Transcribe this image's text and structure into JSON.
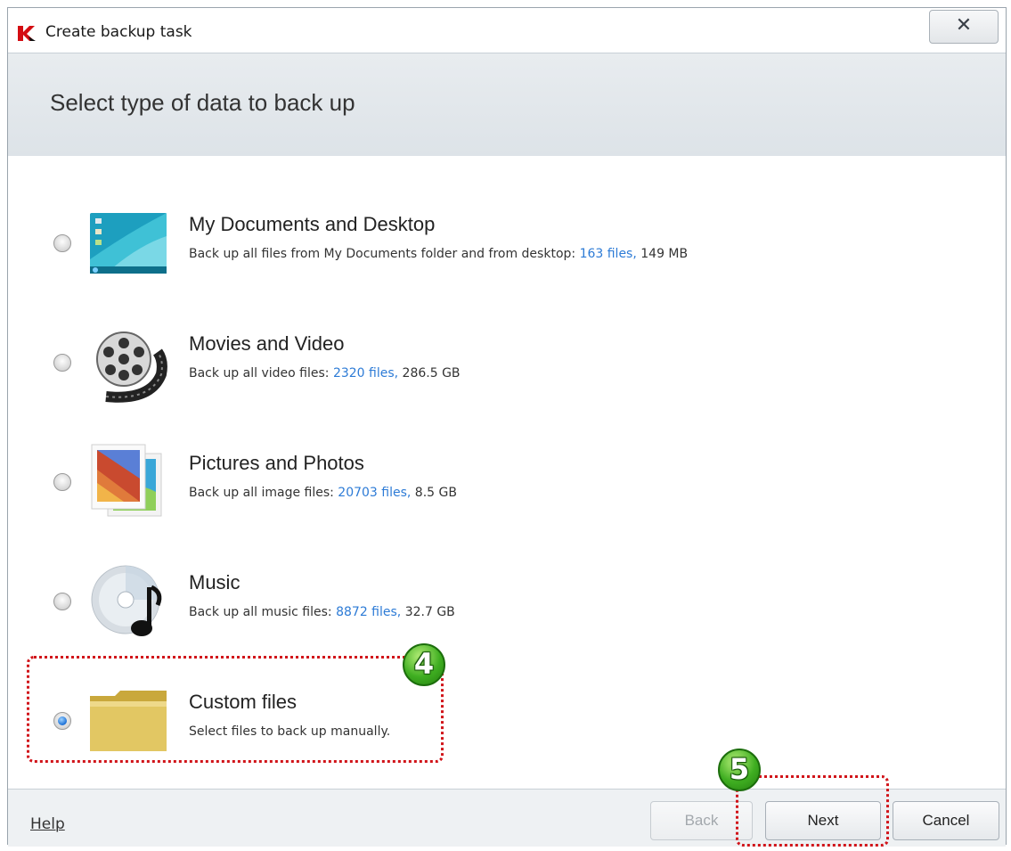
{
  "window": {
    "title": "Create backup task",
    "close_label": "✕"
  },
  "header": {
    "title": "Select type of data to back up"
  },
  "options": [
    {
      "title": "My Documents and Desktop",
      "desc_prefix": "Back up all files from My Documents folder and from desktop: ",
      "files": "163 files,",
      "size": " 149 MB",
      "selected": false,
      "icon": "desktop-icon"
    },
    {
      "title": "Movies and Video",
      "desc_prefix": "Back up all video files: ",
      "files": "2320 files,",
      "size": " 286.5 GB",
      "selected": false,
      "icon": "film-reel-icon"
    },
    {
      "title": "Pictures and Photos",
      "desc_prefix": "Back up all image files: ",
      "files": "20703 files,",
      "size": " 8.5 GB",
      "selected": false,
      "icon": "pictures-icon"
    },
    {
      "title": "Music",
      "desc_prefix": "Back up all music files: ",
      "files": "8872 files,",
      "size": " 32.7 GB",
      "selected": false,
      "icon": "music-cd-icon"
    },
    {
      "title": "Custom files",
      "desc_prefix": "Select files to back up manually.",
      "files": "",
      "size": "",
      "selected": true,
      "icon": "folder-icon"
    }
  ],
  "footer": {
    "help": "Help",
    "back": "Back",
    "next": "Next",
    "cancel": "Cancel"
  },
  "annotations": {
    "step4": "4",
    "step5": "5",
    "color": "#d1141a"
  },
  "colors": {
    "link": "#2d7bd6",
    "header_band": "#e2e7eb"
  }
}
